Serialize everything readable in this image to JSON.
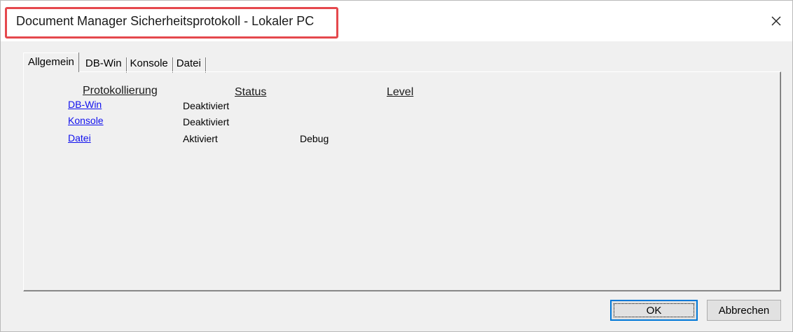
{
  "window": {
    "title": "Document Manager Sicherheitsprotokoll - Lokaler PC",
    "close_icon": "close-icon"
  },
  "tabs": [
    {
      "label": "Allgemein",
      "active": true
    },
    {
      "label": "DB-Win",
      "active": false
    },
    {
      "label": "Konsole",
      "active": false
    },
    {
      "label": "Datei",
      "active": false
    }
  ],
  "table": {
    "headers": {
      "protokollierung": "Protokollierung",
      "status": "Status",
      "level": "Level"
    },
    "rows": [
      {
        "name": "DB-Win",
        "status": "Deaktiviert",
        "level": ""
      },
      {
        "name": "Konsole",
        "status": "Deaktiviert",
        "level": ""
      },
      {
        "name": "Datei",
        "status": "Aktiviert",
        "level": "Debug"
      }
    ]
  },
  "buttons": {
    "ok": "OK",
    "cancel": "Abbrechen"
  },
  "colors": {
    "highlight": "#e5484d",
    "link": "#1010ee",
    "dialog_bg": "#f0f0f0"
  }
}
